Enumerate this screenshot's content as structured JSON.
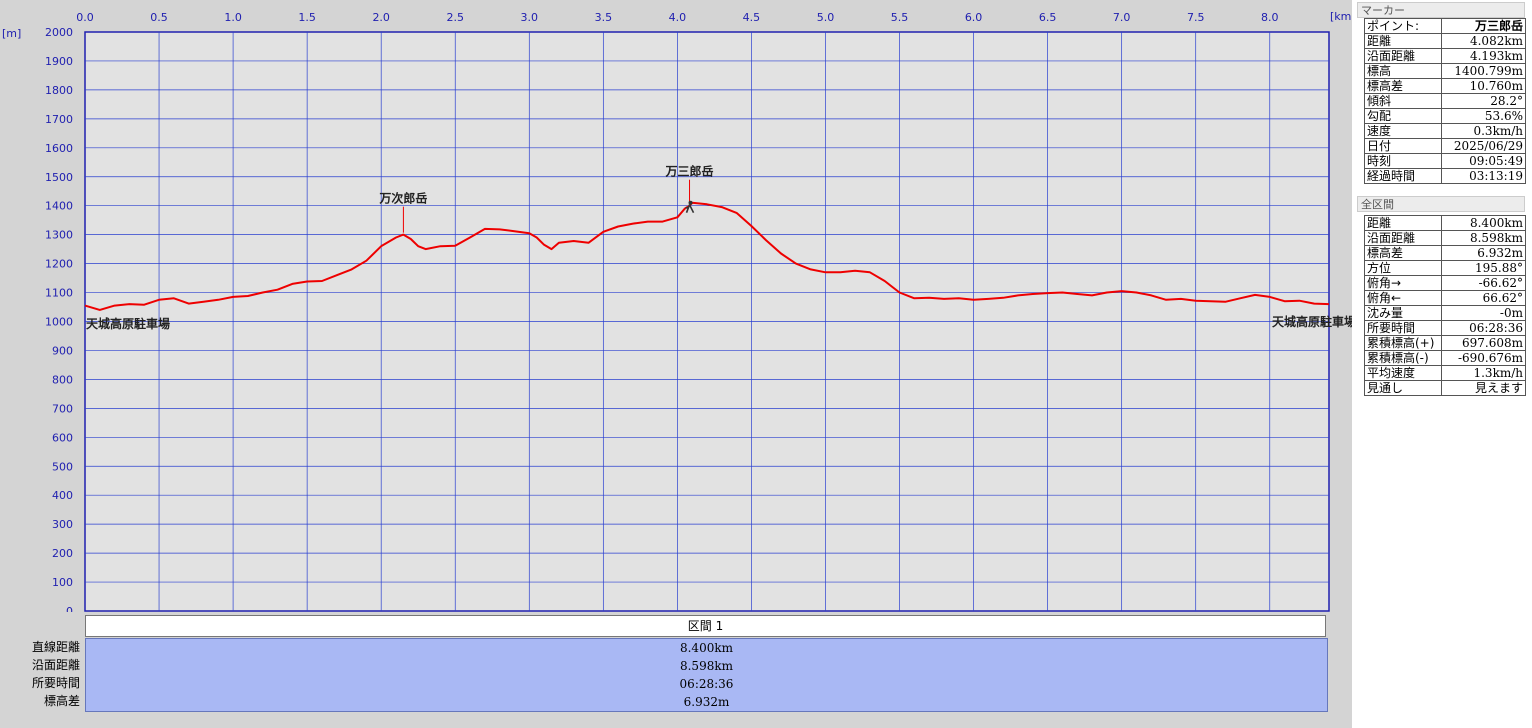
{
  "chart_data": {
    "type": "line",
    "xlabel_unit": "[km]",
    "ylabel_unit": "[m]",
    "xlim": [
      0,
      8.4
    ],
    "ylim": [
      0,
      2000
    ],
    "x_ticks": [
      "0.0",
      "0.5",
      "1.0",
      "1.5",
      "2.0",
      "2.5",
      "3.0",
      "3.5",
      "4.0",
      "4.5",
      "5.0",
      "5.5",
      "6.0",
      "6.5",
      "7.0",
      "7.5",
      "8.0"
    ],
    "y_ticks": [
      "2000",
      "1900",
      "1800",
      "1700",
      "1600",
      "1500",
      "1400",
      "1300",
      "1200",
      "1100",
      "1000",
      "900",
      "800",
      "700",
      "600",
      "500",
      "400",
      "300",
      "200",
      "100",
      "0"
    ],
    "grid": true,
    "line_color": "#ee0000",
    "series": [
      {
        "x": [
          0.0,
          0.1,
          0.2,
          0.3,
          0.4,
          0.5,
          0.6,
          0.7,
          0.8,
          0.9,
          1.0,
          1.1,
          1.2,
          1.3,
          1.4,
          1.5,
          1.6,
          1.7,
          1.8,
          1.9,
          2.0,
          2.1,
          2.15,
          2.2,
          2.25,
          2.3,
          2.4,
          2.5,
          2.6,
          2.7,
          2.8,
          2.9,
          3.0,
          3.05,
          3.1,
          3.15,
          3.2,
          3.3,
          3.4,
          3.5,
          3.6,
          3.7,
          3.8,
          3.9,
          4.0,
          4.05,
          4.082,
          4.1,
          4.2,
          4.3,
          4.4,
          4.5,
          4.6,
          4.7,
          4.8,
          4.9,
          5.0,
          5.1,
          5.2,
          5.3,
          5.4,
          5.5,
          5.6,
          5.7,
          5.8,
          5.9,
          6.0,
          6.1,
          6.2,
          6.3,
          6.4,
          6.5,
          6.6,
          6.7,
          6.8,
          6.9,
          7.0,
          7.1,
          7.2,
          7.3,
          7.4,
          7.5,
          7.6,
          7.7,
          7.8,
          7.9,
          8.0,
          8.1,
          8.2,
          8.3,
          8.4
        ],
        "y": [
          1055,
          1040,
          1055,
          1060,
          1058,
          1075,
          1080,
          1062,
          1068,
          1075,
          1085,
          1088,
          1100,
          1110,
          1130,
          1138,
          1140,
          1160,
          1180,
          1210,
          1260,
          1290,
          1300,
          1285,
          1260,
          1250,
          1260,
          1262,
          1290,
          1320,
          1318,
          1312,
          1305,
          1290,
          1265,
          1250,
          1272,
          1278,
          1272,
          1310,
          1328,
          1338,
          1345,
          1345,
          1360,
          1390,
          1400,
          1410,
          1405,
          1395,
          1375,
          1330,
          1280,
          1235,
          1200,
          1180,
          1170,
          1170,
          1175,
          1170,
          1140,
          1100,
          1080,
          1082,
          1078,
          1080,
          1075,
          1078,
          1082,
          1090,
          1095,
          1098,
          1100,
          1095,
          1090,
          1100,
          1105,
          1100,
          1090,
          1075,
          1078,
          1072,
          1070,
          1068,
          1080,
          1092,
          1085,
          1070,
          1072,
          1062,
          1060
        ]
      }
    ],
    "annotations": [
      {
        "label": "天城高原駐車場",
        "x": 0.0,
        "y": 1055
      },
      {
        "label": "万次郎岳",
        "x": 2.15,
        "y": 1300
      },
      {
        "label": "万三郎岳",
        "x": 4.082,
        "y": 1400
      },
      {
        "label": "天城高原駐車場",
        "x": 8.4,
        "y": 1060
      }
    ]
  },
  "marker_panel": {
    "title": "マーカー",
    "rows": [
      {
        "key": "ポイント:",
        "value": "万三郎岳"
      },
      {
        "key": "距離",
        "value": "4.082km"
      },
      {
        "key": "沿面距離",
        "value": "4.193km"
      },
      {
        "key": "標高",
        "value": "1400.799m"
      },
      {
        "key": "標高差",
        "value": "10.760m"
      },
      {
        "key": "傾斜",
        "value": "28.2°"
      },
      {
        "key": "勾配",
        "value": "53.6%"
      },
      {
        "key": "速度",
        "value": "0.3km/h"
      },
      {
        "key": "日付",
        "value": "2025/06/29"
      },
      {
        "key": "時刻",
        "value": "09:05:49"
      },
      {
        "key": "経過時間",
        "value": "03:13:19"
      }
    ]
  },
  "total_panel": {
    "title": "全区間",
    "rows": [
      {
        "key": "距離",
        "value": "8.400km"
      },
      {
        "key": "沿面距離",
        "value": "8.598km"
      },
      {
        "key": "標高差",
        "value": "6.932m"
      },
      {
        "key": "方位",
        "value": "195.88°"
      },
      {
        "key": "俯角→",
        "value": "-66.62°"
      },
      {
        "key": "俯角←",
        "value": "66.62°"
      },
      {
        "key": "沈み量",
        "value": "-0m"
      },
      {
        "key": "所要時間",
        "value": "06:28:36"
      },
      {
        "key": "累積標高(+)",
        "value": "697.608m"
      },
      {
        "key": "累積標高(-)",
        "value": "-690.676m"
      },
      {
        "key": "平均速度",
        "value": "1.3km/h"
      },
      {
        "key": "見通し",
        "value": "見えます"
      }
    ]
  },
  "section": {
    "header": "区間 1",
    "labels": [
      "直線距離",
      "沿面距離",
      "所要時間",
      "標高差"
    ],
    "values": [
      "8.400km",
      "8.598km",
      "06:28:36",
      "6.932m"
    ]
  }
}
